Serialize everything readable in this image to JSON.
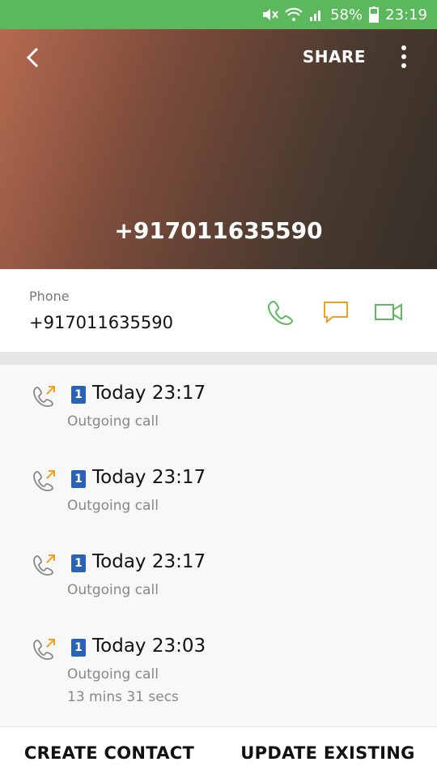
{
  "status_bar": {
    "battery": "58%",
    "time": "23:19",
    "icons": [
      "mute-icon",
      "wifi-icon",
      "signal-icon",
      "battery-icon"
    ]
  },
  "header": {
    "share_label": "SHARE",
    "number": "+917011635590",
    "icons": [
      "back-arrow-icon",
      "more-options-icon"
    ]
  },
  "phone": {
    "label": "Phone",
    "number": "+917011635590",
    "actions": [
      "call-icon",
      "message-icon",
      "video-call-icon"
    ],
    "colors": {
      "call": "#5cb85c",
      "message": "#f0a020",
      "video": "#5cb85c"
    }
  },
  "call_log": [
    {
      "sim": "1",
      "time": "Today 23:17",
      "type": "Outgoing call",
      "duration": ""
    },
    {
      "sim": "1",
      "time": "Today 23:17",
      "type": "Outgoing call",
      "duration": ""
    },
    {
      "sim": "1",
      "time": "Today 23:17",
      "type": "Outgoing call",
      "duration": ""
    },
    {
      "sim": "1",
      "time": "Today 23:03",
      "type": "Outgoing call",
      "duration": "13 mins 31 secs"
    }
  ],
  "bottom_bar": {
    "create_label": "CREATE CONTACT",
    "update_label": "UPDATE EXISTING"
  }
}
